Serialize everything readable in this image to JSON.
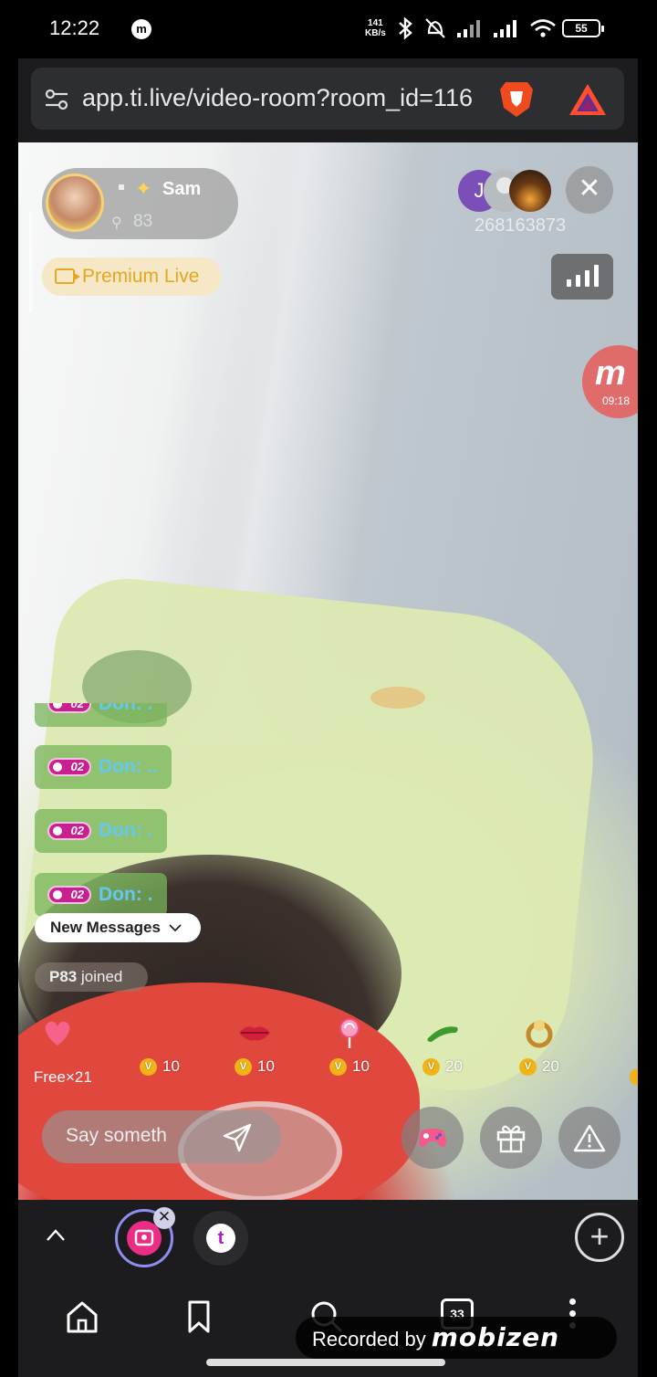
{
  "status_bar": {
    "time": "12:22",
    "net_speed_value": "141",
    "net_speed_unit": "KB/s",
    "battery": "55"
  },
  "browser": {
    "url": "app.ti.live/video-room?room_id=116"
  },
  "room": {
    "host_name": "Sam",
    "viewer_count": "83",
    "premium_label": "Premium Live",
    "room_id": "268163873",
    "viewer_avatar_initial": "J"
  },
  "recorder": {
    "logo_letter": "m",
    "timer": "09:18",
    "recorded_by": "Recorded by",
    "brand": "mobizen"
  },
  "chat": {
    "messages": [
      {
        "level": "02",
        "name": "Don: ."
      },
      {
        "level": "02",
        "name": "Don: .."
      },
      {
        "level": "02",
        "name": "Don: ."
      },
      {
        "level": "02",
        "name": "Don: ."
      }
    ],
    "new_messages_label": "New Messages",
    "join_user": "P83",
    "join_text": "joined"
  },
  "gifts": {
    "free_label": "Free×21",
    "items": [
      {
        "icon": "heart-gift",
        "price": "10"
      },
      {
        "icon": "lips-gift",
        "price": "10"
      },
      {
        "icon": "lollipop-gift",
        "price": "10"
      },
      {
        "icon": "cucumber-gift",
        "price": "20"
      },
      {
        "icon": "ring-gift",
        "price": "20"
      }
    ],
    "coin_symbol": "V"
  },
  "input": {
    "placeholder": "Say someth"
  },
  "tabs": {
    "count": "33",
    "second_tab_letter": "t"
  },
  "colors": {
    "premium": "#e3a81f",
    "chat_name": "#63c9f0",
    "level_badge": "#c8208f",
    "coin": "#f2b315"
  }
}
